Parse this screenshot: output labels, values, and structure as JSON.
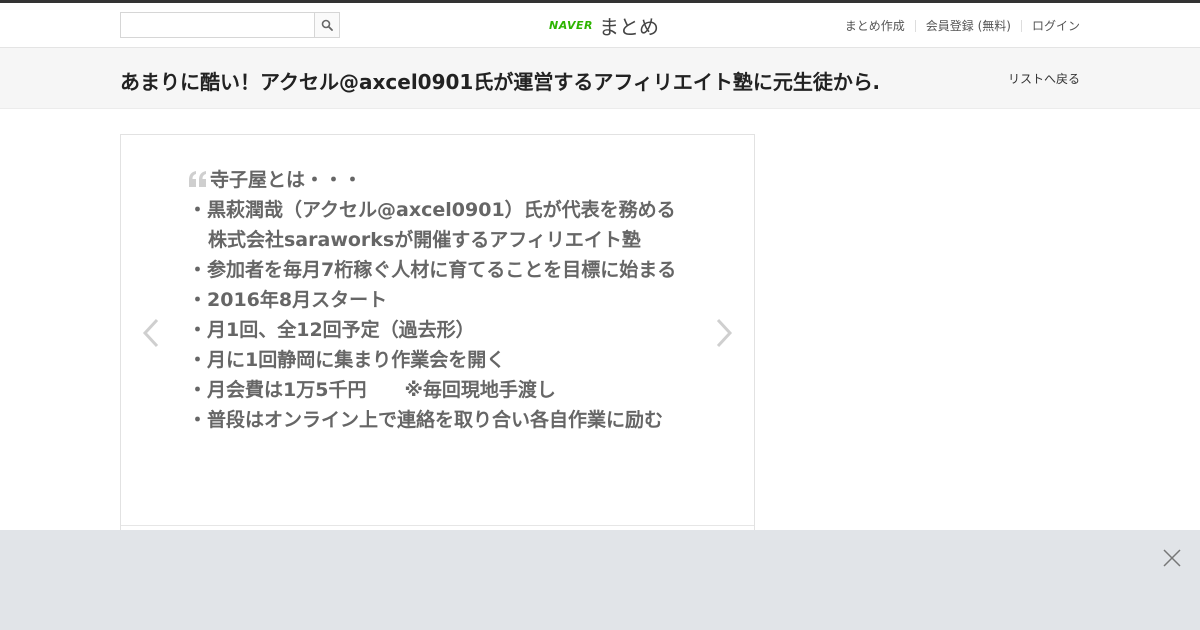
{
  "header": {
    "search": {
      "placeholder": "",
      "value": ""
    },
    "logo": {
      "brand": "NAVER",
      "product": "まとめ"
    },
    "nav": [
      {
        "label": "まとめ作成"
      },
      {
        "label": "会員登録 (無料)"
      },
      {
        "label": "ログイン"
      }
    ]
  },
  "titlebar": {
    "title": "あまりに酷い！アクセル@axcel0901氏が運営するアフィリエイト塾に元生徒から…",
    "back_label": "リストへ戻る"
  },
  "card": {
    "lines": [
      "寺子屋とは・・・",
      "・黒萩潤哉（アクセル@axcel0901）氏が代表を務める",
      "株式会社saraworksが開催するアフィリエイト塾",
      "・参加者を毎月7桁稼ぐ人材に育てることを目標に始まる",
      "・2016年8月スタート",
      "・月1回、全12回予定（過去形）",
      "・月に1回静岡に集まり作業会を開く",
      "・月会費は1万5千円　　※毎回現地手渡し",
      "・普段はオンライン上で連絡を取り合い各自作業に励む"
    ]
  },
  "icons": {
    "search": "search-icon",
    "prev": "chevron-left-icon",
    "next": "chevron-right-icon",
    "quote": "quote-icon",
    "close": "close-icon"
  },
  "colors": {
    "naver_green": "#2db400",
    "banner_bg": "#e1e4e8",
    "title_bg": "#f6f6f6"
  }
}
